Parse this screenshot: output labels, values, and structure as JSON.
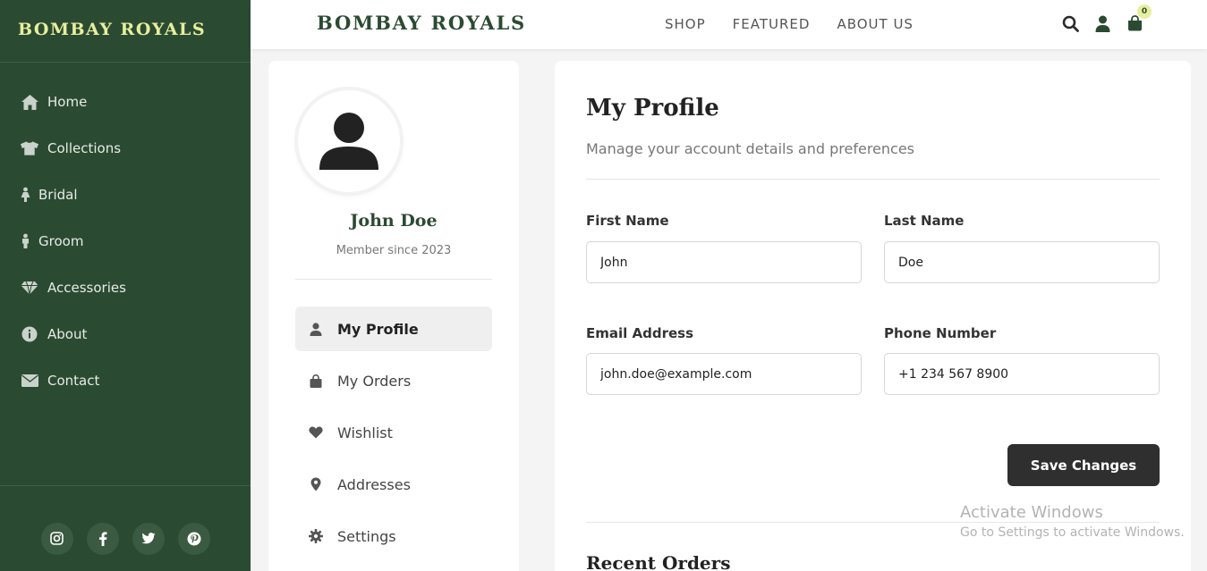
{
  "brand": "BOMBAY ROYALS",
  "colors": {
    "sidebar_bg": "#2b4a32",
    "brand_accent": "#e7ef9d",
    "button_dark": "#2f2f2f"
  },
  "sidebar": {
    "items": [
      {
        "label": "Home",
        "icon": "home-icon"
      },
      {
        "label": "Collections",
        "icon": "tshirt-icon"
      },
      {
        "label": "Bridal",
        "icon": "female-icon"
      },
      {
        "label": "Groom",
        "icon": "male-icon"
      },
      {
        "label": "Accessories",
        "icon": "gem-icon"
      },
      {
        "label": "About",
        "icon": "info-icon"
      },
      {
        "label": "Contact",
        "icon": "envelope-icon"
      }
    ],
    "social": [
      "instagram-icon",
      "facebook-icon",
      "twitter-icon",
      "pinterest-icon"
    ]
  },
  "topbar": {
    "nav": [
      "SHOP",
      "FEATURED",
      "ABOUT US"
    ],
    "cart_count": "0"
  },
  "profile": {
    "name": "John Doe",
    "member_since": "Member since 2023",
    "menu": [
      {
        "label": "My Profile",
        "icon": "user-icon",
        "active": true
      },
      {
        "label": "My Orders",
        "icon": "shopping-bag-icon",
        "active": false
      },
      {
        "label": "Wishlist",
        "icon": "heart-icon",
        "active": false
      },
      {
        "label": "Addresses",
        "icon": "map-marker-icon",
        "active": false
      },
      {
        "label": "Settings",
        "icon": "gear-icon",
        "active": false
      }
    ]
  },
  "main": {
    "title": "My Profile",
    "subtitle": "Manage your account details and preferences",
    "fields": {
      "first_name": {
        "label": "First Name",
        "value": "John"
      },
      "last_name": {
        "label": "Last Name",
        "value": "Doe"
      },
      "email": {
        "label": "Email Address",
        "value": "john.doe@example.com"
      },
      "phone": {
        "label": "Phone Number",
        "value": "+1 234 567 8900"
      }
    },
    "save_label": "Save Changes",
    "next_section": "Recent Orders"
  },
  "watermark": {
    "line1": "Activate Windows",
    "line2": "Go to Settings to activate Windows."
  }
}
